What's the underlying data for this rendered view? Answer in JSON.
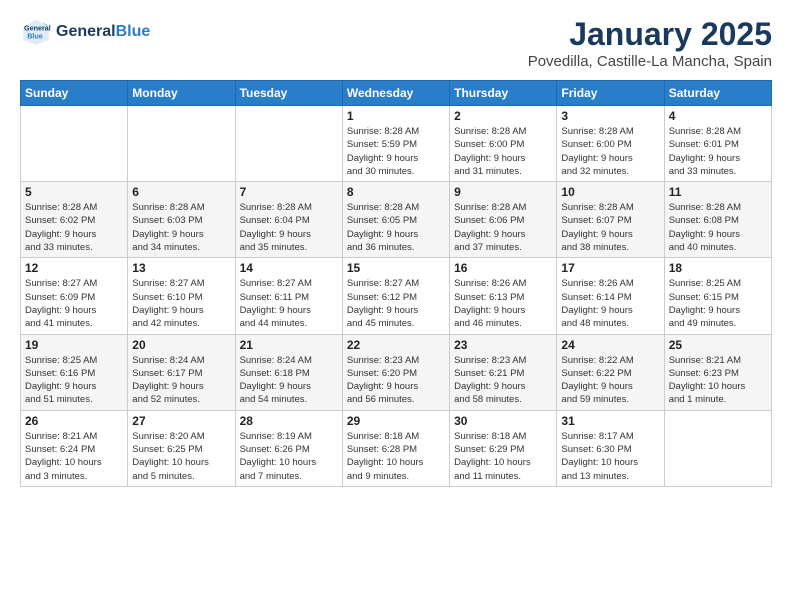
{
  "logo": {
    "text_general": "General",
    "text_blue": "Blue"
  },
  "header": {
    "month": "January 2025",
    "location": "Povedilla, Castille-La Mancha, Spain"
  },
  "weekdays": [
    "Sunday",
    "Monday",
    "Tuesday",
    "Wednesday",
    "Thursday",
    "Friday",
    "Saturday"
  ],
  "weeks": [
    [
      {
        "day": "",
        "detail": ""
      },
      {
        "day": "",
        "detail": ""
      },
      {
        "day": "",
        "detail": ""
      },
      {
        "day": "1",
        "detail": "Sunrise: 8:28 AM\nSunset: 5:59 PM\nDaylight: 9 hours\nand 30 minutes."
      },
      {
        "day": "2",
        "detail": "Sunrise: 8:28 AM\nSunset: 6:00 PM\nDaylight: 9 hours\nand 31 minutes."
      },
      {
        "day": "3",
        "detail": "Sunrise: 8:28 AM\nSunset: 6:00 PM\nDaylight: 9 hours\nand 32 minutes."
      },
      {
        "day": "4",
        "detail": "Sunrise: 8:28 AM\nSunset: 6:01 PM\nDaylight: 9 hours\nand 33 minutes."
      }
    ],
    [
      {
        "day": "5",
        "detail": "Sunrise: 8:28 AM\nSunset: 6:02 PM\nDaylight: 9 hours\nand 33 minutes."
      },
      {
        "day": "6",
        "detail": "Sunrise: 8:28 AM\nSunset: 6:03 PM\nDaylight: 9 hours\nand 34 minutes."
      },
      {
        "day": "7",
        "detail": "Sunrise: 8:28 AM\nSunset: 6:04 PM\nDaylight: 9 hours\nand 35 minutes."
      },
      {
        "day": "8",
        "detail": "Sunrise: 8:28 AM\nSunset: 6:05 PM\nDaylight: 9 hours\nand 36 minutes."
      },
      {
        "day": "9",
        "detail": "Sunrise: 8:28 AM\nSunset: 6:06 PM\nDaylight: 9 hours\nand 37 minutes."
      },
      {
        "day": "10",
        "detail": "Sunrise: 8:28 AM\nSunset: 6:07 PM\nDaylight: 9 hours\nand 38 minutes."
      },
      {
        "day": "11",
        "detail": "Sunrise: 8:28 AM\nSunset: 6:08 PM\nDaylight: 9 hours\nand 40 minutes."
      }
    ],
    [
      {
        "day": "12",
        "detail": "Sunrise: 8:27 AM\nSunset: 6:09 PM\nDaylight: 9 hours\nand 41 minutes."
      },
      {
        "day": "13",
        "detail": "Sunrise: 8:27 AM\nSunset: 6:10 PM\nDaylight: 9 hours\nand 42 minutes."
      },
      {
        "day": "14",
        "detail": "Sunrise: 8:27 AM\nSunset: 6:11 PM\nDaylight: 9 hours\nand 44 minutes."
      },
      {
        "day": "15",
        "detail": "Sunrise: 8:27 AM\nSunset: 6:12 PM\nDaylight: 9 hours\nand 45 minutes."
      },
      {
        "day": "16",
        "detail": "Sunrise: 8:26 AM\nSunset: 6:13 PM\nDaylight: 9 hours\nand 46 minutes."
      },
      {
        "day": "17",
        "detail": "Sunrise: 8:26 AM\nSunset: 6:14 PM\nDaylight: 9 hours\nand 48 minutes."
      },
      {
        "day": "18",
        "detail": "Sunrise: 8:25 AM\nSunset: 6:15 PM\nDaylight: 9 hours\nand 49 minutes."
      }
    ],
    [
      {
        "day": "19",
        "detail": "Sunrise: 8:25 AM\nSunset: 6:16 PM\nDaylight: 9 hours\nand 51 minutes."
      },
      {
        "day": "20",
        "detail": "Sunrise: 8:24 AM\nSunset: 6:17 PM\nDaylight: 9 hours\nand 52 minutes."
      },
      {
        "day": "21",
        "detail": "Sunrise: 8:24 AM\nSunset: 6:18 PM\nDaylight: 9 hours\nand 54 minutes."
      },
      {
        "day": "22",
        "detail": "Sunrise: 8:23 AM\nSunset: 6:20 PM\nDaylight: 9 hours\nand 56 minutes."
      },
      {
        "day": "23",
        "detail": "Sunrise: 8:23 AM\nSunset: 6:21 PM\nDaylight: 9 hours\nand 58 minutes."
      },
      {
        "day": "24",
        "detail": "Sunrise: 8:22 AM\nSunset: 6:22 PM\nDaylight: 9 hours\nand 59 minutes."
      },
      {
        "day": "25",
        "detail": "Sunrise: 8:21 AM\nSunset: 6:23 PM\nDaylight: 10 hours\nand 1 minute."
      }
    ],
    [
      {
        "day": "26",
        "detail": "Sunrise: 8:21 AM\nSunset: 6:24 PM\nDaylight: 10 hours\nand 3 minutes."
      },
      {
        "day": "27",
        "detail": "Sunrise: 8:20 AM\nSunset: 6:25 PM\nDaylight: 10 hours\nand 5 minutes."
      },
      {
        "day": "28",
        "detail": "Sunrise: 8:19 AM\nSunset: 6:26 PM\nDaylight: 10 hours\nand 7 minutes."
      },
      {
        "day": "29",
        "detail": "Sunrise: 8:18 AM\nSunset: 6:28 PM\nDaylight: 10 hours\nand 9 minutes."
      },
      {
        "day": "30",
        "detail": "Sunrise: 8:18 AM\nSunset: 6:29 PM\nDaylight: 10 hours\nand 11 minutes."
      },
      {
        "day": "31",
        "detail": "Sunrise: 8:17 AM\nSunset: 6:30 PM\nDaylight: 10 hours\nand 13 minutes."
      },
      {
        "day": "",
        "detail": ""
      }
    ]
  ]
}
